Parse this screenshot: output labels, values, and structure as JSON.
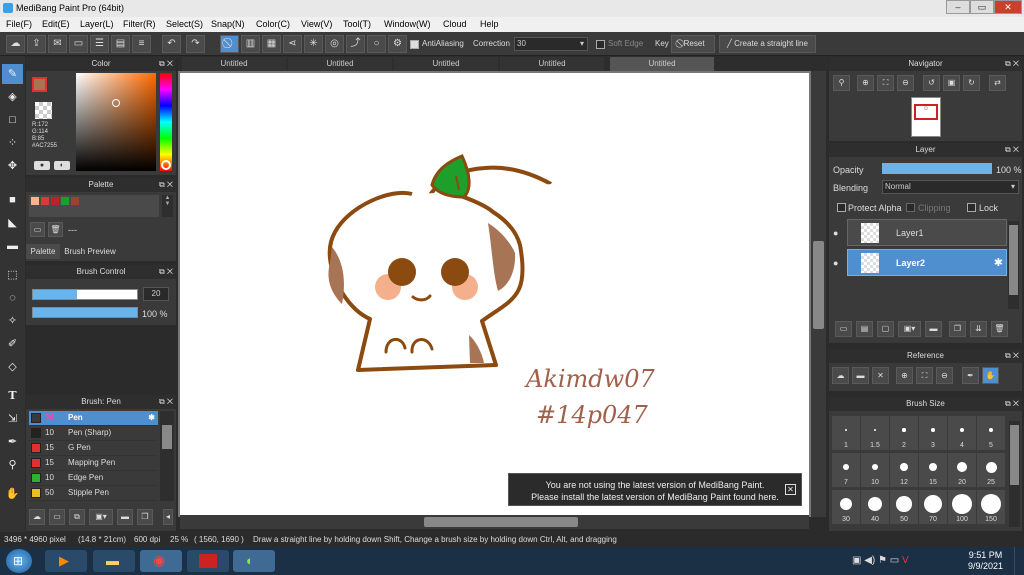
{
  "window": {
    "title": "MediBang Paint Pro (64bit)",
    "min": "–",
    "max": "▭",
    "close": "✕"
  },
  "menu": [
    "File(F)",
    "Edit(E)",
    "Layer(L)",
    "Filter(R)",
    "Select(S)",
    "Snap(N)",
    "Color(C)",
    "View(V)",
    "Tool(T)",
    "Window(W)",
    "Cloud",
    "Help"
  ],
  "toolbar": {
    "antialiasing": "AntiAliasing",
    "correction_label": "Correction",
    "correction_value": "30",
    "soft_edge": "Soft Edge",
    "key": "Key",
    "reset": "Reset",
    "straight_line": "Create a straight line"
  },
  "tabs": [
    "Untitled",
    "Untitled",
    "Untitled",
    "Untitled",
    "Untitled"
  ],
  "color_panel": {
    "title": "Color",
    "r": "R:172",
    "g": "G:114",
    "b": "B:85",
    "hex": "#AC7255",
    "fg": "#AC7255",
    "bg": "#ffffff"
  },
  "palette_panel": {
    "title": "Palette",
    "dash": "---",
    "tab1": "Palette",
    "tab2": "Brush Preview",
    "swatches": [
      "#f5b48c",
      "#d83a3a",
      "#c0202a",
      "#1e9e2a",
      "#a04030"
    ]
  },
  "brush_control": {
    "title": "Brush Control",
    "size": "20",
    "opacity": "100 %",
    "size_fraction": 0.42,
    "opacity_fraction": 1.0
  },
  "brush_list": {
    "title": "Brush: Pen",
    "items": [
      {
        "size": "20",
        "name": "Pen",
        "color": "#3a3a3a"
      },
      {
        "size": "10",
        "name": "Pen (Sharp)",
        "color": "#222"
      },
      {
        "size": "15",
        "name": "G Pen",
        "color": "#e03030"
      },
      {
        "size": "15",
        "name": "Mapping Pen",
        "color": "#e03030"
      },
      {
        "size": "10",
        "name": "Edge Pen",
        "color": "#30b030"
      },
      {
        "size": "50",
        "name": "Stipple Pen",
        "color": "#e8c020"
      }
    ]
  },
  "navigator": {
    "title": "Navigator"
  },
  "layer_panel": {
    "title": "Layer",
    "opacity_label": "Opacity",
    "opacity_value": "100 %",
    "blending_label": "Blending",
    "blending_value": "Normal",
    "protect_alpha": "Protect Alpha",
    "clipping": "Clipping",
    "lock": "Lock",
    "layers": [
      "Layer1",
      "Layer2"
    ]
  },
  "reference": {
    "title": "Reference"
  },
  "brush_size": {
    "title": "Brush Size",
    "sizes": [
      "1",
      "1.5",
      "2",
      "3",
      "4",
      "5",
      "7",
      "10",
      "12",
      "15",
      "20",
      "25",
      "30",
      "40",
      "50",
      "70",
      "100",
      "150"
    ]
  },
  "notification": {
    "line1": "You are not using the latest version of MediBang Paint.",
    "line2": "Please install the latest version of MediBang Paint found here."
  },
  "status": {
    "dims": "3496 * 4960 pixel",
    "cm": "(14.8 * 21cm)",
    "dpi": "600 dpi",
    "zoom": "25 %",
    "coords": "( 1560, 1690 )",
    "hint": "Draw a straight line by holding down Shift, Change a brush size by holding down Ctrl, Alt, and dragging"
  },
  "clock": {
    "time": "9:51 PM",
    "date": "9/9/2021"
  },
  "signature": [
    "Akimdw07",
    "#14p047"
  ]
}
